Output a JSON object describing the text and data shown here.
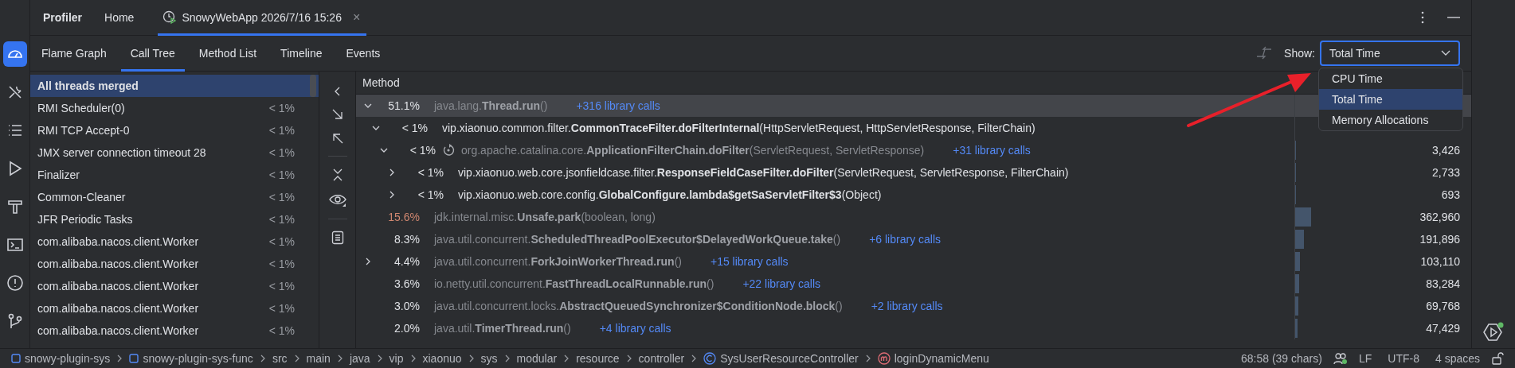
{
  "header": {
    "tool_title": "Profiler",
    "tabs": [
      {
        "label": "Home",
        "kind": "plain",
        "selected": false
      },
      {
        "label": "SnowyWebApp 2026/7/16 15:26",
        "kind": "session",
        "selected": true,
        "close": "×"
      }
    ]
  },
  "tool_strip": [
    {
      "selected": true
    },
    {
      "selected": false
    },
    {
      "selected": false
    },
    {
      "selected": false
    },
    {
      "selected": false
    },
    {
      "selected": false
    },
    {
      "selected": false
    },
    {
      "selected": false
    }
  ],
  "view_tabs": [
    {
      "label": "Flame Graph",
      "selected": false
    },
    {
      "label": "Call Tree",
      "selected": true
    },
    {
      "label": "Method List",
      "selected": false
    },
    {
      "label": "Timeline",
      "selected": false
    },
    {
      "label": "Events",
      "selected": false
    }
  ],
  "show": {
    "label": "Show:",
    "value": "Total Time",
    "expanded": true,
    "options": [
      {
        "label": "CPU Time",
        "selected": false
      },
      {
        "label": "Total Time",
        "selected": true
      },
      {
        "label": "Memory Allocations",
        "selected": false
      }
    ]
  },
  "threads": [
    {
      "name": "All threads merged",
      "selected": true
    },
    {
      "name": "RMI Scheduler(0)",
      "share": "< 1%",
      "selected": false
    },
    {
      "name": "RMI TCP Accept-0",
      "share": "< 1%",
      "selected": false
    },
    {
      "name": "JMX server connection timeout 28",
      "share": "< 1%",
      "selected": false
    },
    {
      "name": "Finalizer",
      "share": "< 1%",
      "selected": false
    },
    {
      "name": "Common-Cleaner",
      "share": "< 1%",
      "selected": false
    },
    {
      "name": "JFR Periodic Tasks",
      "share": "< 1%",
      "selected": false
    },
    {
      "name": "com.alibaba.nacos.client.Worker",
      "share": "< 1%",
      "selected": false
    },
    {
      "name": "com.alibaba.nacos.client.Worker",
      "share": "< 1%",
      "selected": false
    },
    {
      "name": "com.alibaba.nacos.client.Worker",
      "share": "< 1%",
      "selected": false
    },
    {
      "name": "com.alibaba.nacos.client.Worker",
      "share": "< 1%",
      "selected": false
    },
    {
      "name": "com.alibaba.nacos.client.Worker",
      "share": "< 1%",
      "selected": false
    }
  ],
  "table": {
    "columns": [
      "Method"
    ],
    "rows": [
      {
        "percent": "51.1%",
        "kind": "library",
        "method": "java.lang.**Thread.run**()",
        "library_calls": "+316 library calls",
        "hot": false,
        "recursive": false,
        "selected": true,
        "expanded": true,
        "children": [
          {
            "percent": "< 1%",
            "kind": "user",
            "method": "vip.xiaonuo.common.filter.**CommonTraceFilter.doFilterInternal**(HttpServletRequest, HttpServletResponse, FilterChain)",
            "hot": false,
            "recursive": false,
            "selected": false,
            "expanded": true,
            "children": [
              {
                "percent": "< 1%",
                "kind": "library",
                "method": "org.apache.catalina.core.**ApplicationFilterChain.doFilter**(ServletRequest, ServletResponse)",
                "library_calls": "+31 library calls",
                "value": "3,426",
                "level": 0.002,
                "hot": false,
                "recursive": true,
                "selected": false,
                "expanded": true,
                "children": [
                  {
                    "percent": "< 1%",
                    "kind": "user",
                    "method": "vip.xiaonuo.web.core.jsonfieldcase.filter.**ResponseFieldCaseFilter.doFilter**(ServletRequest, ServletResponse, FilterChain)",
                    "value": "2,733",
                    "level": 0.001,
                    "hot": false,
                    "recursive": false,
                    "selected": false,
                    "expanded": false
                  },
                  {
                    "percent": "< 1%",
                    "kind": "user",
                    "method": "vip.xiaonuo.web.core.config.**GlobalConfigure.lambda$getSaServletFilter$3**(Object)",
                    "value": "693",
                    "level": 0.001,
                    "hot": false,
                    "recursive": false,
                    "selected": false,
                    "expanded": false
                  }
                ]
              }
            ]
          }
        ]
      },
      {
        "percent": "15.6%",
        "kind": "library",
        "method": "jdk.internal.misc.**Unsafe.park**(boolean, long)",
        "value": "362,960",
        "level": 0.156,
        "hot": true,
        "recursive": false,
        "selected": false
      },
      {
        "percent": "8.3%",
        "kind": "library",
        "method": "java.util.concurrent.**ScheduledThreadPoolExecutor$DelayedWorkQueue.take**()",
        "library_calls": "+6 library calls",
        "value": "191,896",
        "level": 0.083,
        "hot": false,
        "recursive": false,
        "selected": false
      },
      {
        "percent": "4.4%",
        "kind": "library",
        "method": "java.util.concurrent.**ForkJoinWorkerThread.run**()",
        "library_calls": "+15 library calls",
        "value": "103,110",
        "level": 0.044,
        "hot": false,
        "recursive": false,
        "selected": false,
        "expanded": false
      },
      {
        "percent": "3.6%",
        "kind": "library",
        "method": "io.netty.util.concurrent.**FastThreadLocalRunnable.run**()",
        "library_calls": "+22 library calls",
        "value": "83,284",
        "level": 0.036,
        "hot": false,
        "recursive": false,
        "selected": false
      },
      {
        "percent": "3.0%",
        "kind": "library",
        "method": "java.util.concurrent.locks.**AbstractQueuedSynchronizer$ConditionNode.block**()",
        "library_calls": "+2 library calls",
        "value": "69,768",
        "level": 0.03,
        "hot": false,
        "recursive": false,
        "selected": false
      },
      {
        "percent": "2.0%",
        "kind": "library",
        "method": "java.util.**TimerThread.run**()",
        "library_calls": "+4 library calls",
        "value": "47,429",
        "level": 0.02,
        "hot": false,
        "recursive": false,
        "selected": false
      }
    ]
  },
  "breadcrumbs": [
    {
      "label": "snowy-plugin-sys",
      "kind": "module"
    },
    {
      "label": "snowy-plugin-sys-func",
      "kind": "module"
    },
    {
      "label": "src",
      "kind": "folder"
    },
    {
      "label": "main",
      "kind": "folder"
    },
    {
      "label": "java",
      "kind": "folder"
    },
    {
      "label": "vip",
      "kind": "folder"
    },
    {
      "label": "xiaonuo",
      "kind": "folder"
    },
    {
      "label": "sys",
      "kind": "folder"
    },
    {
      "label": "modular",
      "kind": "folder"
    },
    {
      "label": "resource",
      "kind": "folder"
    },
    {
      "label": "controller",
      "kind": "folder"
    },
    {
      "label": "SysUserResourceController",
      "kind": "class"
    },
    {
      "label": "loginDynamicMenu",
      "kind": "method"
    }
  ],
  "status": [
    "68:58 (39 chars)",
    "LF",
    "UTF-8",
    "4 spaces"
  ]
}
